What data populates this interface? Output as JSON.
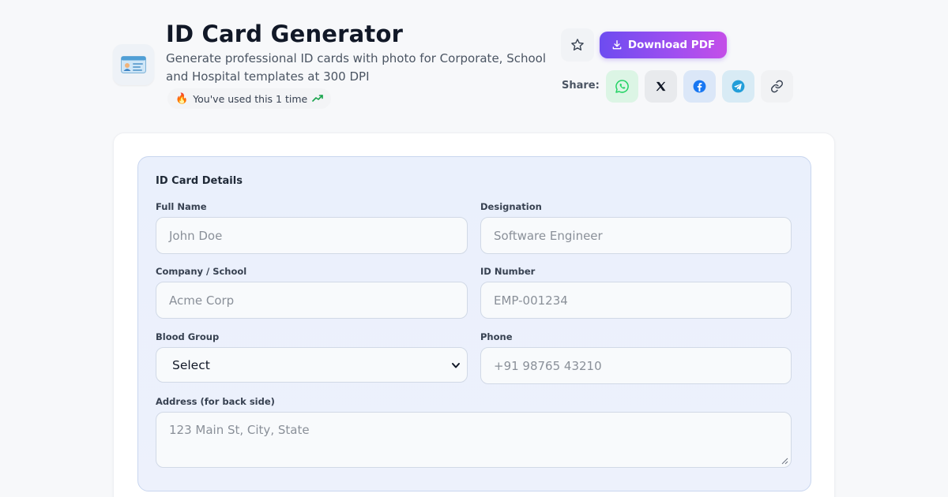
{
  "header": {
    "title": "ID Card Generator",
    "subtitle": "Generate professional ID cards with photo for Corporate, School and Hospital templates at 300 DPI",
    "usage_text": "You've used this 1 time",
    "app_icon": "id-card-icon"
  },
  "actions": {
    "favorite_icon": "star-icon",
    "download_label": "Download PDF",
    "download_icon": "download-icon",
    "share_label": "Share:",
    "share_targets": [
      "whatsapp",
      "x",
      "facebook",
      "telegram",
      "copy-link"
    ]
  },
  "form": {
    "section_title": "ID Card Details",
    "full_name": {
      "label": "Full Name",
      "placeholder": "John Doe"
    },
    "designation": {
      "label": "Designation",
      "placeholder": "Software Engineer"
    },
    "company": {
      "label": "Company / School",
      "placeholder": "Acme Corp"
    },
    "id_number": {
      "label": "ID Number",
      "placeholder": "EMP-001234"
    },
    "blood_group": {
      "label": "Blood Group",
      "value": "Select"
    },
    "phone": {
      "label": "Phone",
      "placeholder": "+91 98765 43210"
    },
    "address": {
      "label": "Address (for back side)",
      "placeholder": "123 Main St, City, State"
    }
  },
  "colors": {
    "accent_start": "#6d4cf0",
    "accent_end": "#c44ee8",
    "whatsapp": "#25d366",
    "facebook": "#1877f2",
    "telegram": "#229ed9",
    "panel_bg": "#eaf0fc"
  }
}
